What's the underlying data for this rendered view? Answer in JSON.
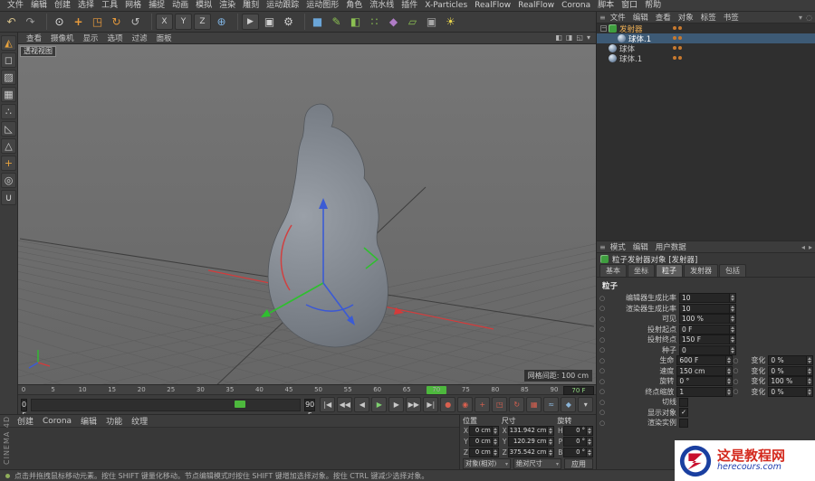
{
  "menubar": {
    "items": [
      "文件",
      "编辑",
      "创建",
      "选择",
      "工具",
      "网格",
      "捕捉",
      "动画",
      "模拟",
      "渲染",
      "雕刻",
      "运动跟踪",
      "运动图形",
      "角色",
      "流水线",
      "插件",
      "X-Particles",
      "RealFlow",
      "RealFlow",
      "Corona",
      "脚本",
      "窗口",
      "帮助"
    ]
  },
  "toolbar": {
    "items": [
      {
        "name": "undo",
        "glyph": "↶",
        "color": "#d6c08a"
      },
      {
        "name": "redo",
        "glyph": "↷",
        "color": "#9a9a9a"
      },
      {
        "sep": true
      },
      {
        "name": "live-selection",
        "glyph": "⊙",
        "color": "#e3e3e3"
      },
      {
        "name": "move",
        "glyph": "+",
        "color": "#e89b3c",
        "bold": true
      },
      {
        "name": "scale",
        "glyph": "◳",
        "color": "#e89b3c"
      },
      {
        "name": "rotate",
        "glyph": "↻",
        "color": "#e89b3c"
      },
      {
        "name": "last-tool",
        "glyph": "↺",
        "color": "#bdbdbd"
      },
      {
        "sep": true
      },
      {
        "name": "lock-x-axis",
        "glyph": "X",
        "color": "#d0d0d0",
        "boxed": true
      },
      {
        "name": "lock-y-axis",
        "glyph": "Y",
        "color": "#d0d0d0",
        "boxed": true
      },
      {
        "name": "lock-z-axis",
        "glyph": "Z",
        "color": "#d0d0d0",
        "boxed": true
      },
      {
        "name": "coordinate-system",
        "glyph": "⊕",
        "color": "#7fb2e0"
      },
      {
        "sep": true
      },
      {
        "name": "render-view",
        "glyph": "▶",
        "color": "#cfcfcf",
        "boxed": true
      },
      {
        "name": "render-picture-viewer",
        "glyph": "▣",
        "color": "#cfcfcf"
      },
      {
        "name": "render-settings",
        "glyph": "⚙",
        "color": "#cfcfcf"
      },
      {
        "sep": true
      },
      {
        "name": "add-primitive",
        "glyph": "■",
        "color": "#6aa5d8"
      },
      {
        "name": "add-spline",
        "glyph": "✎",
        "color": "#8cc152"
      },
      {
        "name": "add-subdivision-surface",
        "glyph": "◧",
        "color": "#8cc152"
      },
      {
        "name": "add-array",
        "glyph": "∷",
        "color": "#8cc152"
      },
      {
        "name": "add-deformer",
        "glyph": "◆",
        "color": "#b07cc6"
      },
      {
        "name": "add-environment",
        "glyph": "▱",
        "color": "#8cc152"
      },
      {
        "name": "add-camera",
        "glyph": "▣",
        "color": "#a8a8a8"
      },
      {
        "name": "add-light",
        "glyph": "☀",
        "color": "#e8d44d"
      }
    ]
  },
  "left_toolbar": {
    "items": [
      {
        "name": "convert-editable",
        "glyph": "◭",
        "color": "#e8a33d"
      },
      {
        "name": "model-mode",
        "glyph": "◻",
        "color": "#cfcfcf"
      },
      {
        "name": "texture-mode",
        "glyph": "▨",
        "color": "#cfcfcf"
      },
      {
        "name": "workplane-mode",
        "glyph": "▦",
        "color": "#cfcfcf"
      },
      {
        "name": "points-mode",
        "glyph": "∴",
        "color": "#cfcfcf"
      },
      {
        "name": "edges-mode",
        "glyph": "◺",
        "color": "#cfcfcf"
      },
      {
        "name": "polygons-mode",
        "glyph": "△",
        "color": "#cfcfcf"
      },
      {
        "name": "enable-axis",
        "glyph": "+",
        "color": "#e8a33d"
      },
      {
        "name": "viewport-solo",
        "glyph": "◎",
        "color": "#cfcfcf"
      },
      {
        "name": "enable-snap",
        "glyph": "∪",
        "color": "#cfcfcf"
      }
    ]
  },
  "viewport": {
    "menus": [
      "查看",
      "摄像机",
      "显示",
      "选项",
      "过滤",
      "面板"
    ],
    "corner_icons": [
      {
        "name": "viewport-toggle-single-view",
        "glyph": "◧"
      },
      {
        "name": "viewport-layout",
        "glyph": "◨"
      },
      {
        "name": "viewport-maximize",
        "glyph": "◱"
      },
      {
        "name": "viewport-options",
        "glyph": "▾"
      }
    ],
    "view_label": "透视视图",
    "grid_spacing": "网格间距: 100 cm"
  },
  "object_manager": {
    "menus": [
      "文件",
      "编辑",
      "查看",
      "对象",
      "标签",
      "书签"
    ],
    "right_icons": [
      {
        "name": "om-filter",
        "glyph": "▾"
      },
      {
        "name": "om-search",
        "glyph": "◌"
      }
    ],
    "items": [
      {
        "label": "发射器",
        "icon": "emitter",
        "depth": 0,
        "has_children": true,
        "state": "active"
      },
      {
        "label": "球体.1",
        "icon": "sphere",
        "depth": 1,
        "state": "selected"
      },
      {
        "label": "球体",
        "icon": "sphere",
        "depth": 0,
        "state": ""
      },
      {
        "label": "球体.1",
        "icon": "sphere",
        "depth": 0,
        "state": ""
      }
    ]
  },
  "attributes": {
    "menus": [
      "模式",
      "编辑",
      "用户数据"
    ],
    "title": "粒子发射器对象 [发射器]",
    "tabs": [
      "基本",
      "坐标",
      "粒子",
      "发射器",
      "包括"
    ],
    "active_tab": "粒子",
    "section": "粒子",
    "params": [
      {
        "label": "编辑器生成比率",
        "value": "10"
      },
      {
        "label": "渲染器生成比率",
        "value": "10"
      },
      {
        "label": "可见",
        "value": "100 %"
      },
      {
        "label": "投射起点",
        "value": "0 F"
      },
      {
        "label": "投射终点",
        "value": "150 F"
      },
      {
        "label": "种子",
        "value": "0"
      },
      {
        "label": "生命",
        "value": "600 F",
        "extra_label": "变化",
        "extra_value": "0 %"
      },
      {
        "label": "速度",
        "value": "150 cm",
        "extra_label": "变化",
        "extra_value": "0 %"
      },
      {
        "label": "旋转",
        "value": "0 °",
        "extra_label": "变化",
        "extra_value": "100 %"
      },
      {
        "label": "终点缩放",
        "value": "1",
        "extra_label": "变化",
        "extra_value": "0 %"
      },
      {
        "label": "切线",
        "checkbox": true,
        "checked": false
      },
      {
        "label": "显示对象",
        "checkbox": true,
        "checked": true
      },
      {
        "label": "渲染实例",
        "checkbox": true,
        "checked": false
      }
    ]
  },
  "timeline": {
    "ticks": [
      "0",
      "5",
      "10",
      "15",
      "20",
      "25",
      "30",
      "35",
      "40",
      "45",
      "50",
      "55",
      "60",
      "65",
      "70",
      "75",
      "80",
      "85",
      "90"
    ],
    "max_frame": 90,
    "playhead_frame": 70,
    "playhead_label": "70",
    "current_frame": "70 F",
    "range_start": "0 F",
    "range_end": "90 F",
    "buttons": [
      {
        "name": "go-to-start",
        "glyph": "|◀"
      },
      {
        "name": "go-to-previous-key",
        "glyph": "◀◀"
      },
      {
        "name": "go-to-previous-frame",
        "glyph": "◀"
      },
      {
        "name": "play",
        "glyph": "▶",
        "accent": "green"
      },
      {
        "name": "go-to-next-frame",
        "glyph": "▶"
      },
      {
        "name": "go-to-next-key",
        "glyph": "▶▶"
      },
      {
        "name": "go-to-end",
        "glyph": "▶|"
      },
      {
        "name": "record-keyframe",
        "glyph": "●",
        "accent": "red"
      },
      {
        "name": "autokeying",
        "glyph": "◉",
        "accent": "red"
      },
      {
        "name": "record-position",
        "glyph": "+",
        "accent": "red"
      },
      {
        "name": "record-scale",
        "glyph": "◳",
        "accent": "red"
      },
      {
        "name": "record-rotation",
        "glyph": "↻",
        "accent": "red"
      },
      {
        "name": "record-parameter",
        "glyph": "▦",
        "accent": "red"
      },
      {
        "name": "record-point-level",
        "glyph": "≈",
        "accent": "blue"
      },
      {
        "name": "keyframe-selection",
        "glyph": "◆",
        "accent": "blue"
      },
      {
        "name": "playback-options",
        "glyph": "▾"
      }
    ]
  },
  "materials": {
    "menus": [
      "创建",
      "Corona",
      "编辑",
      "功能",
      "纹理"
    ]
  },
  "coordinates": {
    "groups": [
      {
        "title": "位置",
        "rows": [
          [
            "X",
            "0 cm"
          ],
          [
            "Y",
            "0 cm"
          ],
          [
            "Z",
            "0 cm"
          ]
        ]
      },
      {
        "title": "尺寸",
        "rows": [
          [
            "X",
            "131.942 cm"
          ],
          [
            "Y",
            "120.29 cm"
          ],
          [
            "Z",
            "375.542 cm"
          ]
        ]
      },
      {
        "title": "旋转",
        "rows": [
          [
            "H",
            "0 °"
          ],
          [
            "P",
            "0 °"
          ],
          [
            "B",
            "0 °"
          ]
        ]
      }
    ],
    "mode_position": "对象(相对)",
    "mode_size": "绝对尺寸",
    "apply": "应用"
  },
  "statusbar": {
    "hint": "点击并拖拽鼠标移动元素。按住 SHIFT 键量化移动。节点编辑模式时按住 SHIFT 键增加选择对象。按住 CTRL 键减少选择对象。"
  },
  "watermark": {
    "site": "这是教程网",
    "url": "herecours.com"
  },
  "brand": {
    "label": "CINEMA 4D"
  }
}
